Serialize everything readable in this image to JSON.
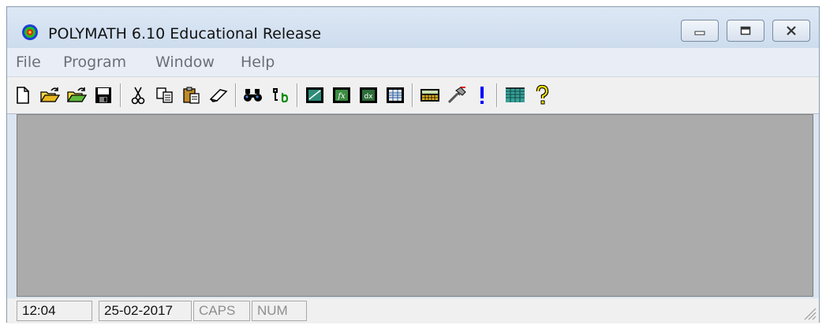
{
  "window": {
    "title": "POLYMATH 6.10 Educational Release"
  },
  "menu": [
    "File",
    "Program",
    "Window",
    "Help"
  ],
  "toolbar": {
    "icons": [
      "new-file-icon",
      "open-file-icon",
      "open-library-icon",
      "save-icon",
      "cut-icon",
      "copy-icon",
      "paste-icon",
      "eraser-icon",
      "find-icon",
      "units-icon",
      "graph-icon",
      "function-icon",
      "derivative-icon",
      "table-icon",
      "calculator-icon",
      "tools-icon",
      "run-icon",
      "grid-icon",
      "help-icon"
    ]
  },
  "status": {
    "time": "12:04",
    "date": "25-02-2017",
    "caps": "CAPS",
    "num": "NUM"
  },
  "colors": {
    "workspace": "#ababab",
    "run_accent": "#0000ff"
  }
}
